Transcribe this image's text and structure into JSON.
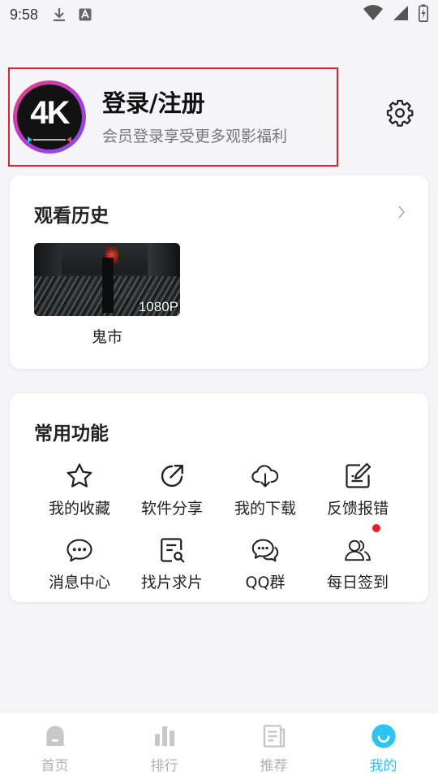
{
  "status_bar": {
    "time": "9:58"
  },
  "profile": {
    "avatar_text": "4K",
    "title": "登录/注册",
    "subtitle": "会员登录享受更多观影福利"
  },
  "history": {
    "title": "观看历史",
    "items": [
      {
        "name": "鬼市",
        "badge": "1080P"
      }
    ]
  },
  "functions": {
    "title": "常用功能",
    "items": [
      {
        "label": "我的收藏",
        "icon": "star-icon"
      },
      {
        "label": "软件分享",
        "icon": "share-icon"
      },
      {
        "label": "我的下载",
        "icon": "cloud-download-icon"
      },
      {
        "label": "反馈报错",
        "icon": "edit-icon"
      },
      {
        "label": "消息中心",
        "icon": "message-icon"
      },
      {
        "label": "找片求片",
        "icon": "search-document-icon"
      },
      {
        "label": "QQ群",
        "icon": "chat-bubbles-icon"
      },
      {
        "label": "每日签到",
        "icon": "users-icon",
        "badge_dot": true
      }
    ]
  },
  "tabbar": {
    "tabs": [
      {
        "label": "首页",
        "icon": "home-icon",
        "active": false
      },
      {
        "label": "排行",
        "icon": "ranking-icon",
        "active": false
      },
      {
        "label": "推荐",
        "icon": "recommend-icon",
        "active": false
      },
      {
        "label": "我的",
        "icon": "profile-smile-icon",
        "active": true
      }
    ]
  },
  "colors": {
    "accent": "#2ec4f1",
    "highlight_border": "#d6262c",
    "notification_dot": "#ee1c25",
    "inactive_tab": "#b0b0b0"
  }
}
